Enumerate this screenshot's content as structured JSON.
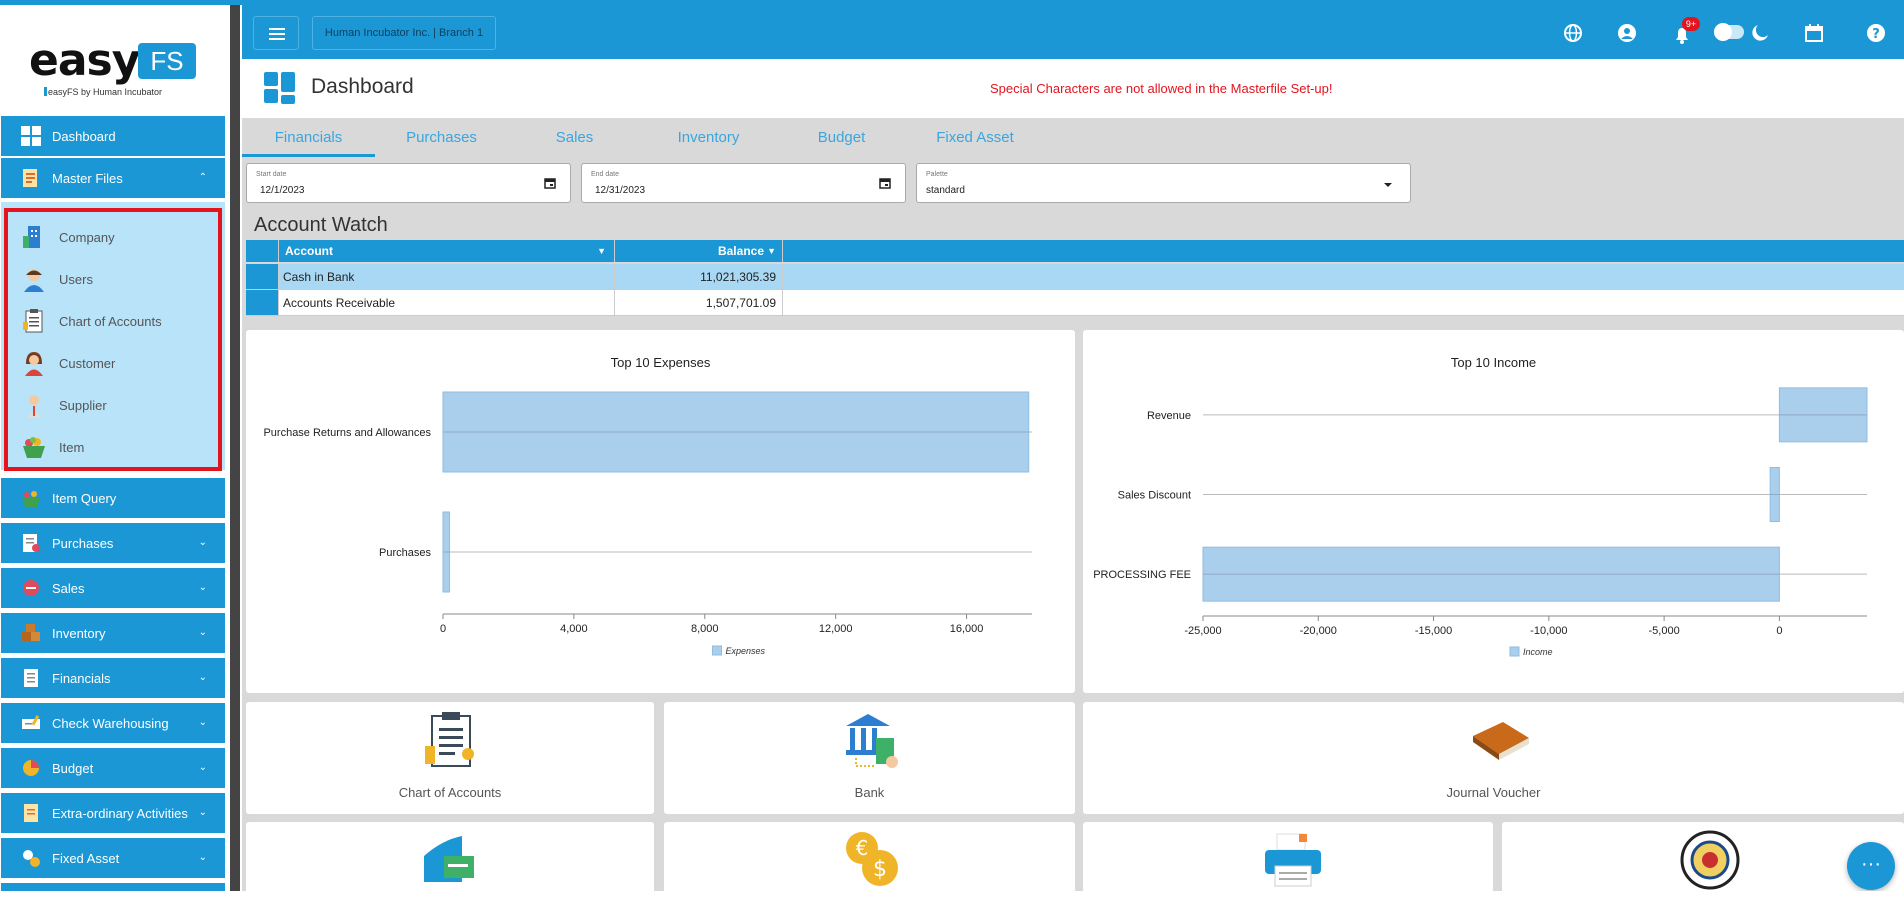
{
  "sidebar": {
    "logo": {
      "easy": "easy",
      "fs": "FS",
      "subtitle": "easyFS by Human Incubator"
    },
    "items": [
      {
        "label": "Dashboard"
      },
      {
        "label": "Master Files"
      },
      {
        "label": "Item Query"
      },
      {
        "label": "Purchases"
      },
      {
        "label": "Sales"
      },
      {
        "label": "Inventory"
      },
      {
        "label": "Financials"
      },
      {
        "label": "Check Warehousing"
      },
      {
        "label": "Budget"
      },
      {
        "label": "Extra-ordinary Activities"
      },
      {
        "label": "Fixed Asset"
      }
    ],
    "master_files_sub": [
      {
        "label": "Company"
      },
      {
        "label": "Users"
      },
      {
        "label": "Chart of Accounts"
      },
      {
        "label": "Customer"
      },
      {
        "label": "Supplier"
      },
      {
        "label": "Item"
      }
    ]
  },
  "topbar": {
    "company": "Human Incubator Inc. | Branch 1",
    "notification_badge": "9+"
  },
  "header": {
    "title": "Dashboard",
    "warning": "Special Characters are not allowed in the Masterfile Set-up!"
  },
  "tabs": [
    {
      "label": "Financials"
    },
    {
      "label": "Purchases"
    },
    {
      "label": "Sales"
    },
    {
      "label": "Inventory"
    },
    {
      "label": "Budget"
    },
    {
      "label": "Fixed Asset"
    }
  ],
  "filters": {
    "start": {
      "label": "Start date",
      "value": "12/1/2023"
    },
    "end": {
      "label": "End date",
      "value": "12/31/2023"
    },
    "palette": {
      "label": "Palette",
      "value": "standard"
    }
  },
  "account_watch": {
    "title": "Account Watch",
    "columns": [
      "Account",
      "Balance"
    ],
    "rows": [
      {
        "account": "Cash in Bank",
        "balance": "11,021,305.39"
      },
      {
        "account": "Accounts Receivable",
        "balance": "1,507,701.09"
      }
    ]
  },
  "chart_data": [
    {
      "type": "bar",
      "orientation": "horizontal",
      "title": "Top 10 Expenses",
      "categories": [
        "Purchase Returns and Allowances",
        "Purchases"
      ],
      "series": [
        {
          "name": "Expenses",
          "values": [
            17900,
            200
          ]
        }
      ],
      "xlim": [
        0,
        18000
      ],
      "ticks": [
        "0",
        "4,000",
        "8,000",
        "12,000",
        "16,000"
      ],
      "tick_values": [
        0,
        4000,
        8000,
        12000,
        16000
      ],
      "legend": "bottom",
      "color": "#aacfec"
    },
    {
      "type": "bar",
      "orientation": "horizontal",
      "title": "Top 10 Income",
      "categories": [
        "Revenue",
        "Sales Discount",
        "PROCESSING FEE"
      ],
      "series": [
        {
          "name": "Income",
          "values": [
            3800,
            -400,
            -25000
          ]
        }
      ],
      "xlim": [
        -25000,
        3800
      ],
      "ticks": [
        "-25,000",
        "-20,000",
        "-15,000",
        "-10,000",
        "-5,000",
        "0"
      ],
      "tick_values": [
        -25000,
        -20000,
        -15000,
        -10000,
        -5000,
        0
      ],
      "legend": "bottom",
      "color": "#aacfec"
    }
  ],
  "tiles": [
    {
      "label": "Chart of Accounts"
    },
    {
      "label": "Bank"
    },
    {
      "label": "Journal Voucher"
    }
  ]
}
